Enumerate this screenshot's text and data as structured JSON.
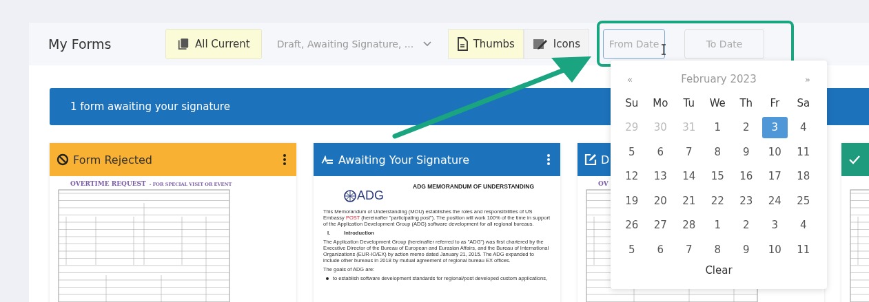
{
  "header": {
    "title": "My Forms",
    "filter": {
      "label": "All Current",
      "selected": true
    },
    "status_select": {
      "value": "Draft, Awaiting Signature, ..."
    },
    "views": [
      {
        "label": "Thumbs",
        "selected": true,
        "kind": "thumbs"
      },
      {
        "label": "Icons",
        "selected": false,
        "kind": "icons"
      }
    ],
    "from_date": {
      "placeholder": "From Date",
      "focused": true
    },
    "to_date": {
      "placeholder": "To Date",
      "focused": false
    }
  },
  "banner": "1 form awaiting your signature",
  "cards": [
    {
      "kind": "rejected",
      "title": "Form Rejected",
      "menu": true,
      "color": "#f8b133",
      "preview": {
        "kind": "overtime",
        "heading": "OVERTIME REQUEST",
        "subheading": "- FOR SPECIAL VISIT OR EVENT"
      }
    },
    {
      "kind": "signature",
      "title": "Awaiting Your Signature",
      "menu": true,
      "color": "#1c72bb",
      "preview": {
        "kind": "memo",
        "logo": "ADG",
        "heading": "ADG MEMORANDUM OF UNDERSTANDING",
        "intro": {
          "before": "This Memorandum of Understanding (MOU) establishes the roles and responsibilities of US Embassy",
          "highlight": "POST",
          "after": "(hereinafter \"participating post\").  The position will work 100% of the time in support of the Application Development Group (ADG) software development for all regional bureaus."
        },
        "section": {
          "number": "I.",
          "title": "Introduction"
        },
        "paragraphs": [
          "The Application Development Group (hereinafter referred to as \"ADG\") was first chartered by the Executive Director of the Bureau of European and Eurasian Affairs, and the Bureau of International Organizations (EUR-IO/EX) by action memo dated January 21, 2015.  The ADG expanded to include other bureaus in 2018 by mutual agreement of regional bureau EX offices.",
          "The goals of ADG are:"
        ],
        "bullets": [
          "to establish software development standards for regional/post developed custom applications,"
        ]
      }
    },
    {
      "kind": "draft",
      "title": "D",
      "color": "#1c72bb",
      "preview": {
        "kind": "overtime",
        "heading": "OV"
      }
    },
    {
      "kind": "approved",
      "color": "#1e9a7c",
      "preview": {
        "kind": "overtime"
      }
    }
  ],
  "calendar": {
    "prev": "«",
    "next": "»",
    "month": "February 2023",
    "weekdays": [
      "Su",
      "Mo",
      "Tu",
      "We",
      "Th",
      "Fr",
      "Sa"
    ],
    "weeks": [
      [
        {
          "day": "29",
          "muted": true,
          "selected": false
        },
        {
          "day": "30",
          "muted": true,
          "selected": false
        },
        {
          "day": "31",
          "muted": true,
          "selected": false
        },
        {
          "day": "1",
          "muted": false,
          "selected": false
        },
        {
          "day": "2",
          "muted": false,
          "selected": false
        },
        {
          "day": "3",
          "muted": false,
          "selected": true
        },
        {
          "day": "4",
          "muted": false,
          "selected": false
        }
      ],
      [
        {
          "day": "5",
          "muted": false,
          "selected": false
        },
        {
          "day": "6",
          "muted": false,
          "selected": false
        },
        {
          "day": "7",
          "muted": false,
          "selected": false
        },
        {
          "day": "8",
          "muted": false,
          "selected": false
        },
        {
          "day": "9",
          "muted": false,
          "selected": false
        },
        {
          "day": "10",
          "muted": false,
          "selected": false
        },
        {
          "day": "11",
          "muted": false,
          "selected": false
        }
      ],
      [
        {
          "day": "12",
          "muted": false,
          "selected": false
        },
        {
          "day": "13",
          "muted": false,
          "selected": false
        },
        {
          "day": "14",
          "muted": false,
          "selected": false
        },
        {
          "day": "15",
          "muted": false,
          "selected": false
        },
        {
          "day": "16",
          "muted": false,
          "selected": false
        },
        {
          "day": "17",
          "muted": false,
          "selected": false
        },
        {
          "day": "18",
          "muted": false,
          "selected": false
        }
      ],
      [
        {
          "day": "19",
          "muted": false,
          "selected": false
        },
        {
          "day": "20",
          "muted": false,
          "selected": false
        },
        {
          "day": "21",
          "muted": false,
          "selected": false
        },
        {
          "day": "22",
          "muted": false,
          "selected": false
        },
        {
          "day": "23",
          "muted": false,
          "selected": false
        },
        {
          "day": "24",
          "muted": false,
          "selected": false
        },
        {
          "day": "25",
          "muted": false,
          "selected": false
        }
      ],
      [
        {
          "day": "26",
          "muted": false,
          "selected": false
        },
        {
          "day": "27",
          "muted": false,
          "selected": false
        },
        {
          "day": "28",
          "muted": false,
          "selected": false
        },
        {
          "day": "1",
          "muted": false,
          "selected": false
        },
        {
          "day": "2",
          "muted": false,
          "selected": false
        },
        {
          "day": "3",
          "muted": false,
          "selected": false
        },
        {
          "day": "4",
          "muted": false,
          "selected": false
        }
      ],
      [
        {
          "day": "5",
          "muted": false,
          "selected": false
        },
        {
          "day": "6",
          "muted": false,
          "selected": false
        },
        {
          "day": "7",
          "muted": false,
          "selected": false
        },
        {
          "day": "8",
          "muted": false,
          "selected": false
        },
        {
          "day": "9",
          "muted": false,
          "selected": false
        },
        {
          "day": "10",
          "muted": false,
          "selected": false
        },
        {
          "day": "11",
          "muted": false,
          "selected": false
        }
      ]
    ],
    "clear": "Clear"
  }
}
